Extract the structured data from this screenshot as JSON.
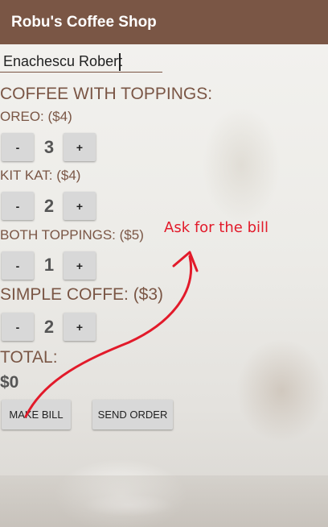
{
  "app": {
    "title": "Robu's Coffee Shop"
  },
  "customer": {
    "name": "Enachescu Robert"
  },
  "headers": {
    "coffee_with_toppings": "COFFEE WITH TOPPINGS:",
    "total_label": "TOTAL:"
  },
  "items": [
    {
      "label": "OREO: ($4)",
      "quantity": "3"
    },
    {
      "label": "KIT KAT: ($4)",
      "quantity": "2"
    },
    {
      "label": "BOTH TOPPINGS: ($5)",
      "quantity": "1"
    },
    {
      "label": "SIMPLE COFFE: ($3)",
      "quantity": "2"
    }
  ],
  "stepper": {
    "minus_label": "-",
    "plus_label": "+"
  },
  "total": {
    "value": "$0"
  },
  "buttons": {
    "make_bill": "MAKE BILL",
    "send_order": "SEND ORDER"
  },
  "annotation": {
    "text": "Ask for the bill",
    "color": "#e21a2a"
  },
  "colors": {
    "app_bar": "#7a5645",
    "accent_text": "#7a5645",
    "button_bg": "#d8d8d8"
  }
}
